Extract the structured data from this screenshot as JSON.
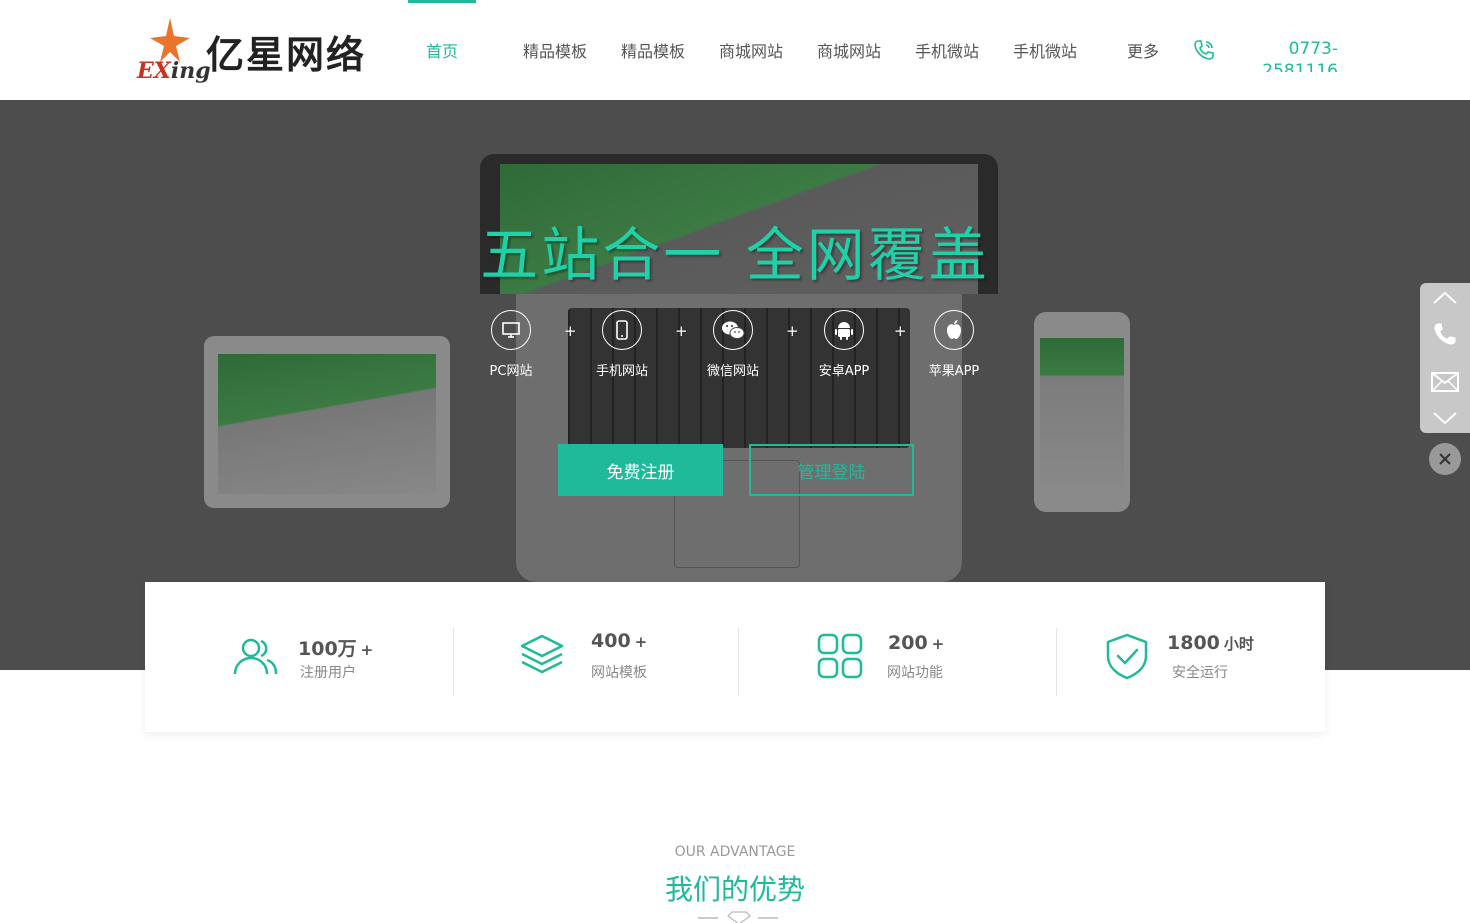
{
  "brand": {
    "logo_text": "亿星网络",
    "logo_sub_ex": "EX",
    "logo_sub_ing": "ing",
    "accent": "#1fba9a",
    "logo_red": "#c8321e"
  },
  "nav": {
    "items": [
      {
        "label": "首页",
        "active": true
      },
      {
        "label": "精品模板"
      },
      {
        "label": "精品模板"
      },
      {
        "label": "商城网站"
      },
      {
        "label": "商城网站"
      },
      {
        "label": "手机微站"
      },
      {
        "label": "手机微站"
      },
      {
        "label": "更多"
      }
    ],
    "phone_icon": "phone-call-icon",
    "phone_number": "0773-2581116"
  },
  "banner": {
    "title": "五站合一 全网覆盖",
    "platforms": [
      {
        "label": "PC网站",
        "icon": "monitor-icon"
      },
      {
        "label": "手机网站",
        "icon": "mobile-icon"
      },
      {
        "label": "微信网站",
        "icon": "wechat-icon"
      },
      {
        "label": "安卓APP",
        "icon": "android-icon"
      },
      {
        "label": "苹果APP",
        "icon": "apple-icon"
      }
    ],
    "plus": "+",
    "register_label": "免费注册",
    "login_label": "管理登陆"
  },
  "stats": [
    {
      "value": "100万",
      "unit": "+",
      "label": "注册用户",
      "icon": "users-icon"
    },
    {
      "value": "400",
      "unit": "+",
      "label": "网站模板",
      "icon": "layers-icon"
    },
    {
      "value": "200",
      "unit": "+",
      "label": "网站功能",
      "icon": "grid-icon"
    },
    {
      "value": "1800",
      "unit": "小时",
      "label": "安全运行",
      "icon": "shield-check-icon"
    }
  ],
  "advantage": {
    "subtitle_en": "OUR ADVANTAGE",
    "title": "我们的优势"
  }
}
